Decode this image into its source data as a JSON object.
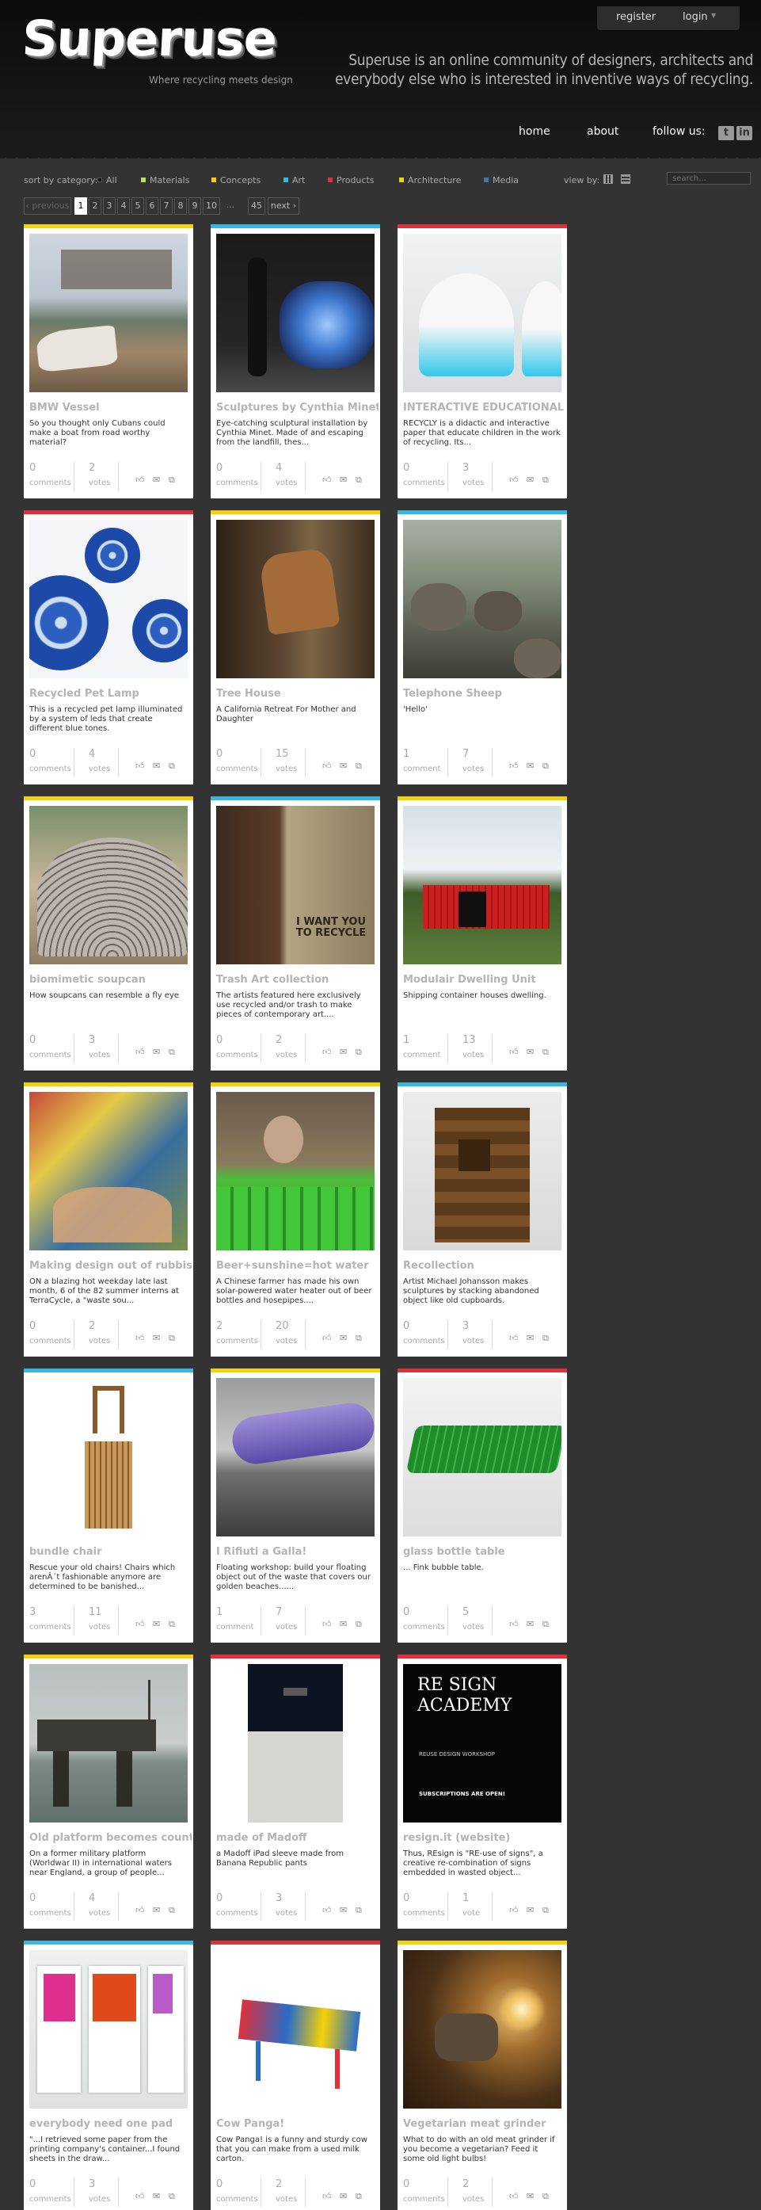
{
  "site": {
    "logo_text": "Superuse",
    "logo_tagline": "Where recycling meets design",
    "tagline": "Superuse is an online community of designers, architects and everybody else who is interested in inventive ways of recycling."
  },
  "userbar": {
    "register": "register",
    "login": "login"
  },
  "nav": {
    "home": "home",
    "about": "about",
    "follow": "follow us:",
    "social_1": "t",
    "social_2": "in"
  },
  "filters": {
    "sort_label": "sort by category:",
    "categories": [
      {
        "label": "All",
        "color": "#111111"
      },
      {
        "label": "Materials",
        "color": "#b7e05a"
      },
      {
        "label": "Concepts",
        "color": "#f5d10a"
      },
      {
        "label": "Art",
        "color": "#38b8e0"
      },
      {
        "label": "Products",
        "color": "#e0303a"
      },
      {
        "label": "Architecture",
        "color": "#f5d10a"
      },
      {
        "label": "Media",
        "color": "#3a7ea8"
      }
    ],
    "view_label": "view by:",
    "search_placeholder": "search..."
  },
  "pagination": {
    "prev": "‹ previous",
    "pages": [
      "1",
      "2",
      "3",
      "4",
      "5",
      "6",
      "7",
      "8",
      "9",
      "10"
    ],
    "current": "1",
    "dots": "...",
    "last": "45",
    "next": "next ›"
  },
  "cards": [
    {
      "title": "BMW Vessel",
      "desc": "So you thought only Cubans could make a boat from road worthy material?",
      "comments": "0",
      "comments_label": "comments",
      "votes": "2",
      "votes_label": "votes",
      "color": "#f5d10a",
      "thumb": "t-bmw"
    },
    {
      "title": "Sculptures by Cynthia Minet",
      "desc": "Eye-catching sculptural installation by Cynthia Minet. Made of and escaping from the landfill, thes...",
      "comments": "0",
      "comments_label": "comments",
      "votes": "4",
      "votes_label": "votes",
      "color": "#38b8e0",
      "thumb": "t-sculpt"
    },
    {
      "title": "INTERACTIVE EDUCATIONAL",
      "desc": "RECYCLY is a didactic and interactive paper that educate children in the work of recycling. Its...",
      "comments": "0",
      "comments_label": "comments",
      "votes": "3",
      "votes_label": "votes",
      "color": "#e0303a",
      "thumb": "t-interactive"
    },
    {
      "title": "Recycled Pet Lamp",
      "desc": "This is a recycled pet lamp illuminated by a system of leds that create different blue tones.",
      "comments": "0",
      "comments_label": "comments",
      "votes": "4",
      "votes_label": "votes",
      "color": "#e0303a",
      "thumb": "t-lamp"
    },
    {
      "title": "Tree House",
      "desc": "A California Retreat For Mother and Daughter",
      "comments": "0",
      "comments_label": "comments",
      "votes": "15",
      "votes_label": "votes",
      "color": "#f5d10a",
      "thumb": "t-tree"
    },
    {
      "title": "Telephone Sheep",
      "desc": "'Hello'",
      "comments": "1",
      "comments_label": "comment",
      "votes": "7",
      "votes_label": "votes",
      "color": "#38b8e0",
      "thumb": "t-sheep"
    },
    {
      "title": "biomimetic soupcan",
      "desc": "How soupcans can resemble a fly eye",
      "comments": "0",
      "comments_label": "comments",
      "votes": "3",
      "votes_label": "votes",
      "color": "#f5d10a",
      "thumb": "t-soup"
    },
    {
      "title": "Trash Art collection",
      "desc": "The artists featured here exclusively use recycled and/or trash to make pieces of contemporary art....",
      "comments": "0",
      "comments_label": "comments",
      "votes": "2",
      "votes_label": "votes",
      "color": "#38b8e0",
      "thumb": "t-trash"
    },
    {
      "title": "Modulair Dwelling Unit",
      "desc": "Shipping container houses dwelling.",
      "comments": "1",
      "comments_label": "comment",
      "votes": "13",
      "votes_label": "votes",
      "color": "#f5d10a",
      "thumb": "t-modulair"
    },
    {
      "title": "Making design out of rubbish",
      "desc": "ON a blazing hot weekday late last month, 6 of the 82 summer interns at TerraCycle, a \"waste sou...",
      "comments": "0",
      "comments_label": "comments",
      "votes": "2",
      "votes_label": "votes",
      "color": "#f5d10a",
      "thumb": "t-making"
    },
    {
      "title": "Beer+sunshine=hot water",
      "desc": "A Chinese farmer has made his own solar-powered water heater out of beer bottles and hosepipes....",
      "comments": "2",
      "comments_label": "comments",
      "votes": "20",
      "votes_label": "votes",
      "color": "#f5d10a",
      "thumb": "t-beer"
    },
    {
      "title": "Recollection",
      "desc": "Artist Michael Johansson makes sculptures by stacking abandoned object like old cupboards.",
      "comments": "0",
      "comments_label": "comments",
      "votes": "3",
      "votes_label": "votes",
      "color": "#38b8e0",
      "thumb": "t-recoll"
    },
    {
      "title": "bundle chair",
      "desc": "Rescue your old chairs! Chairs which arenÂ´t fashionable anymore are determined to be banished...",
      "comments": "3",
      "comments_label": "comments",
      "votes": "11",
      "votes_label": "votes",
      "color": "#38b8e0",
      "thumb": "t-chair"
    },
    {
      "title": "I Rifiuti a Galla!",
      "desc": "Floating workshop: build your floating object out of the waste that covers our golden beaches......",
      "comments": "1",
      "comments_label": "comment",
      "votes": "7",
      "votes_label": "votes",
      "color": "#f5d10a",
      "thumb": "t-rifiuti"
    },
    {
      "title": "glass bottle table",
      "desc": "... Fink bubble table.",
      "comments": "0",
      "comments_label": "comments",
      "votes": "5",
      "votes_label": "votes",
      "color": "#e0303a",
      "thumb": "t-glass"
    },
    {
      "title": "Old platform becomes country",
      "desc": "On a former military platform (Worldwar II) in international waters near England, a group of people...",
      "comments": "0",
      "comments_label": "comments",
      "votes": "4",
      "votes_label": "votes",
      "color": "#f5d10a",
      "thumb": "t-platform"
    },
    {
      "title": "made of Madoff",
      "desc": "a Madoff iPad sleeve made from Banana Republic pants",
      "comments": "0",
      "comments_label": "comments",
      "votes": "3",
      "votes_label": "votes",
      "color": "#e0303a",
      "thumb": "t-madoff"
    },
    {
      "title": "resign.it (website)",
      "desc": "Thus, REsign is \"RE-use of signs\", a creative re-combination of signs embedded in wasted object...",
      "comments": "0",
      "comments_label": "comments",
      "votes": "1",
      "votes_label": "vote",
      "color": "#e0303a",
      "thumb": "t-resign"
    },
    {
      "title": "everybody need one pad",
      "desc": "\"...I retrieved some paper from the printing company's container...I found sheets in the draw...",
      "comments": "0",
      "comments_label": "comments",
      "votes": "3",
      "votes_label": "votes",
      "color": "#38b8e0",
      "thumb": "t-pad"
    },
    {
      "title": "Cow Panga!",
      "desc": "Cow Panga! is a funny and sturdy cow that you can make from a used milk carton.",
      "comments": "0",
      "comments_label": "comments",
      "votes": "2",
      "votes_label": "votes",
      "color": "#e0303a",
      "thumb": "t-cow"
    },
    {
      "title": "Vegetarian meat grinder",
      "desc": "What to do with an old meat grinder if you become a vegetarian? Feed it some old light bulbs!",
      "comments": "0",
      "comments_label": "comments",
      "votes": "2",
      "votes_label": "votes",
      "color": "#f5d10a",
      "thumb": "t-grinder"
    }
  ],
  "resign_thumb": {
    "title": "RE SIGN ACADEMY",
    "subtitle": "REUSE DESIGN WORKSHOP",
    "notice": "SUBSCRIPTIONS ARE OPEN!"
  },
  "trash_thumb": {
    "poster": "I WANT YOU TO RECYCLE"
  }
}
